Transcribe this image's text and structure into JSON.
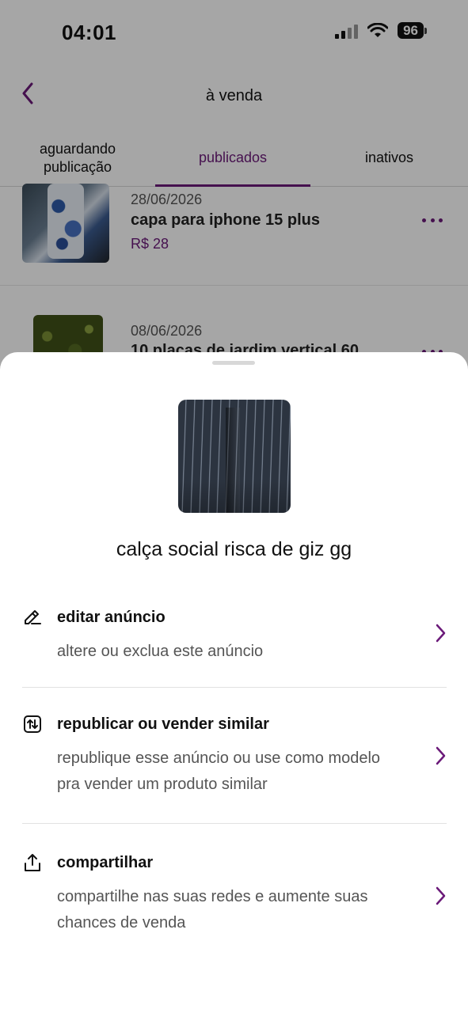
{
  "status_bar": {
    "time": "04:01",
    "battery": "96",
    "icons": [
      "signal-icon",
      "wifi-icon",
      "battery-icon"
    ]
  },
  "header": {
    "title": "à venda",
    "back_icon": "chevron-left-icon"
  },
  "tabs": [
    {
      "label": "aguardando\npublicação",
      "active": false
    },
    {
      "label": "publicados",
      "active": true
    },
    {
      "label": "inativos",
      "active": false
    }
  ],
  "listings": [
    {
      "date": "28/06/2026",
      "title": "capa para iphone 15 plus",
      "price": "R$ 28"
    },
    {
      "date": "08/06/2026",
      "title": "10 placas de jardim vertical 60"
    }
  ],
  "sheet": {
    "product_title": "calça social risca de giz gg",
    "actions": [
      {
        "icon": "pencil-icon",
        "title": "editar anúncio",
        "description": "altere ou exclua este anúncio"
      },
      {
        "icon": "republish-icon",
        "title": "republicar ou vender similar",
        "description": "republique esse anúncio ou use como modelo pra vender um produto similar"
      },
      {
        "icon": "share-icon",
        "title": "compartilhar",
        "description": "compartilhe nas suas redes e aumente suas chances de venda"
      }
    ]
  },
  "colors": {
    "accent": "#6b1a79",
    "overlay": "rgba(0,0,0,0.35)",
    "text": "#111111",
    "muted": "#555555"
  }
}
